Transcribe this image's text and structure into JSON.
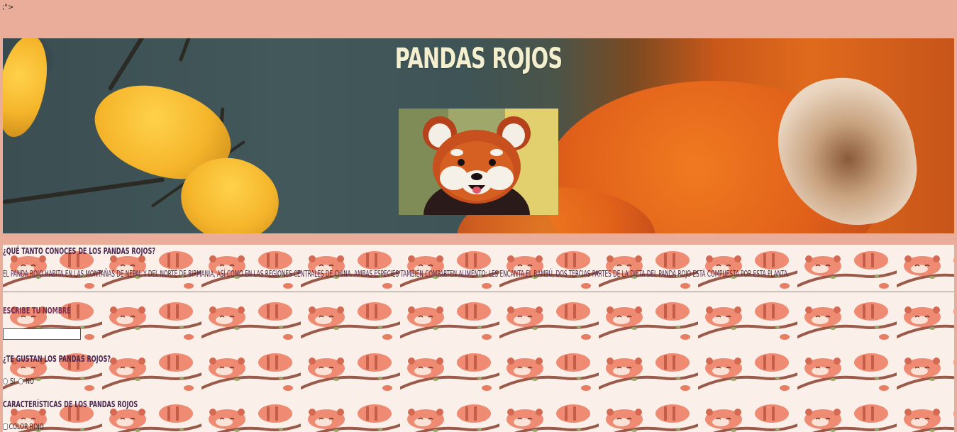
{
  "stray_text": ";\">",
  "header": {
    "title": "PANDAS ROJOS",
    "photo_alt": "Panda rojo"
  },
  "intro": {
    "question": "¿Qué tanto conoces de los pandas rojos?",
    "paragraph": "El panda rojo habita en las montañas de Nepal y del norte de Birmania, así como en las regiones centrales de China. Ambas especies también comparten alimento: les encanta el bambú, dos tercias partes de la dieta del panda rojo está compuesta por esta planta."
  },
  "form": {
    "name_label": "Escribe tu nombre",
    "name_value": "",
    "likes_label": "¿Te gustan los pandas rojos?",
    "radio_options": [
      "Si",
      "No"
    ],
    "traits_label": "Características de los pandas rojos",
    "checkbox_options": [
      "Color rojo"
    ]
  },
  "colors": {
    "page_background": "#e9ad99",
    "title_color": "#f4efcf",
    "text_color": "#4b2a52"
  }
}
